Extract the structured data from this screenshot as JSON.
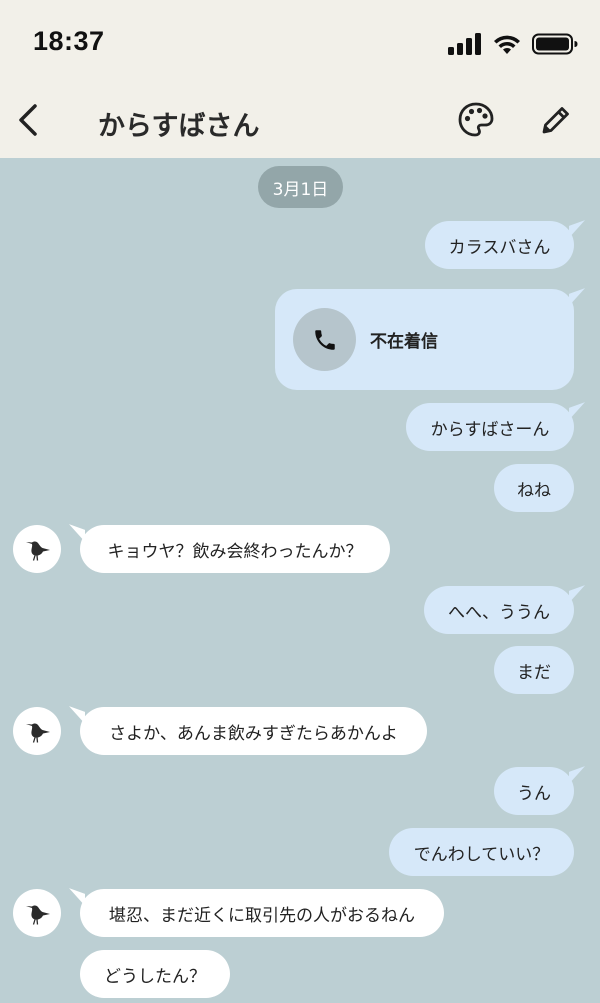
{
  "status_bar": {
    "time": "18:37",
    "icons": [
      "cellular-signal-icon",
      "wifi-icon",
      "battery-icon"
    ]
  },
  "header": {
    "back_icon": "chevron-left-icon",
    "title": "からすばさん",
    "palette_icon": "palette-icon",
    "edit_icon": "pencil-icon"
  },
  "chat": {
    "date": "3月1日",
    "messages": [
      {
        "side": "out",
        "text": "カラスバさん"
      },
      {
        "side": "out",
        "type": "missed-call",
        "text": "不在着信",
        "icon": "phone-icon"
      },
      {
        "side": "out",
        "text": "からすばさーん"
      },
      {
        "side": "out",
        "text": "ねね"
      },
      {
        "side": "in",
        "text": "キョウヤ？飲み会終わったんか？",
        "avatar": "crow-icon"
      },
      {
        "side": "out",
        "text": "へへ、ううん"
      },
      {
        "side": "out",
        "text": "まだ"
      },
      {
        "side": "in",
        "text": "さよか、あんま飲みすぎたらあかんよ",
        "avatar": "crow-icon"
      },
      {
        "side": "out",
        "text": "うん"
      },
      {
        "side": "out",
        "text": "でんわしていい？"
      },
      {
        "side": "in",
        "text": "堪忍、まだ近くに取引先の人がおるねん",
        "avatar": "crow-icon"
      },
      {
        "side": "in",
        "text": "どうしたん？"
      }
    ]
  },
  "colors": {
    "background": "#bccfd3",
    "header": "#f2f0e9",
    "outgoing_bubble": "#d6e8f9",
    "incoming_bubble": "#ffffff",
    "date_pill": "#93a6a9"
  }
}
